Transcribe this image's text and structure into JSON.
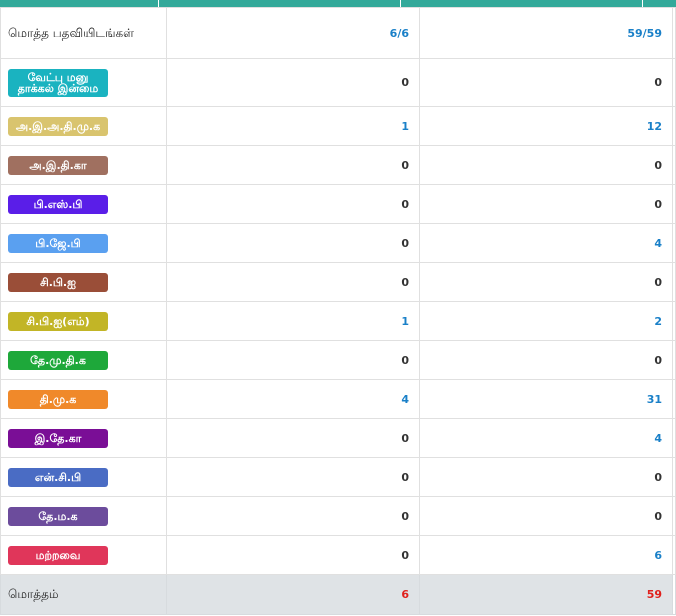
{
  "header": {
    "label": "மொத்த பதவியிடங்கள்",
    "col1": "6/6",
    "col2": "59/59"
  },
  "parties": [
    {
      "label": "வேட்பு மனு தாக்கல் இன்மை",
      "color": "#1ab3c0",
      "v1": "0",
      "v2": "0"
    },
    {
      "label": "அ.இ.அ.தி.மு.க",
      "color": "#d9c46e",
      "v1": "1",
      "v2": "12"
    },
    {
      "label": "அ.இ.தி.கா",
      "color": "#a07060",
      "v1": "0",
      "v2": "0"
    },
    {
      "label": "பி.எஸ்.பி",
      "color": "#5a1ee8",
      "v1": "0",
      "v2": "0"
    },
    {
      "label": "பி.ஜே.பி",
      "color": "#5aa0f0",
      "v1": "0",
      "v2": "4"
    },
    {
      "label": "சி.பி.ஐ",
      "color": "#9a4e38",
      "v1": "0",
      "v2": "0"
    },
    {
      "label": "சி.பி.ஐ(எம்)",
      "color": "#c2b526",
      "v1": "1",
      "v2": "2"
    },
    {
      "label": "தே.மு.தி.க",
      "color": "#1ea83a",
      "v1": "0",
      "v2": "0"
    },
    {
      "label": "தி.மு.க",
      "color": "#f0892a",
      "v1": "4",
      "v2": "31"
    },
    {
      "label": "இ.தே.கா",
      "color": "#7a0e96",
      "v1": "0",
      "v2": "4"
    },
    {
      "label": "என்.சி.பி",
      "color": "#4a6cc4",
      "v1": "0",
      "v2": "0"
    },
    {
      "label": "தே.ம.க",
      "color": "#6c4c9c",
      "v1": "0",
      "v2": "0"
    },
    {
      "label": "மற்றவை",
      "color": "#e0365a",
      "v1": "0",
      "v2": "6"
    }
  ],
  "total": {
    "label": "மொத்தம்",
    "col1": "6",
    "col2": "59"
  },
  "colors": {
    "header_bar": "#33a99a",
    "positive_number": "#1a80c8",
    "total_number": "#e0201c"
  }
}
